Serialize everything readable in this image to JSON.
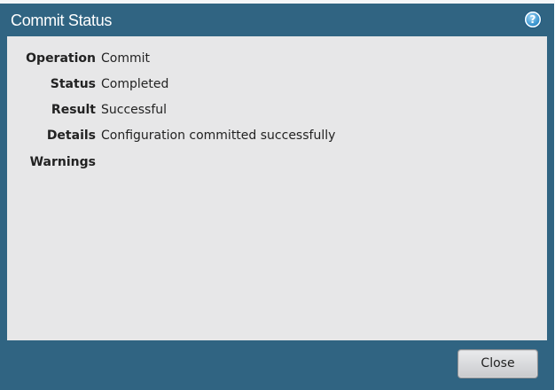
{
  "dialog": {
    "title": "Commit Status",
    "help_icon": "help-icon",
    "help_glyph": "?"
  },
  "details": {
    "rows": [
      {
        "label": "Operation",
        "value": "Commit"
      },
      {
        "label": "Status",
        "value": "Completed"
      },
      {
        "label": "Result",
        "value": "Successful"
      },
      {
        "label": "Details",
        "value": "Configuration committed successfully"
      },
      {
        "label": "Warnings",
        "value": ""
      }
    ]
  },
  "footer": {
    "close_label": "Close"
  },
  "colors": {
    "frame": "#306482",
    "content_bg": "#e7e7e8"
  }
}
